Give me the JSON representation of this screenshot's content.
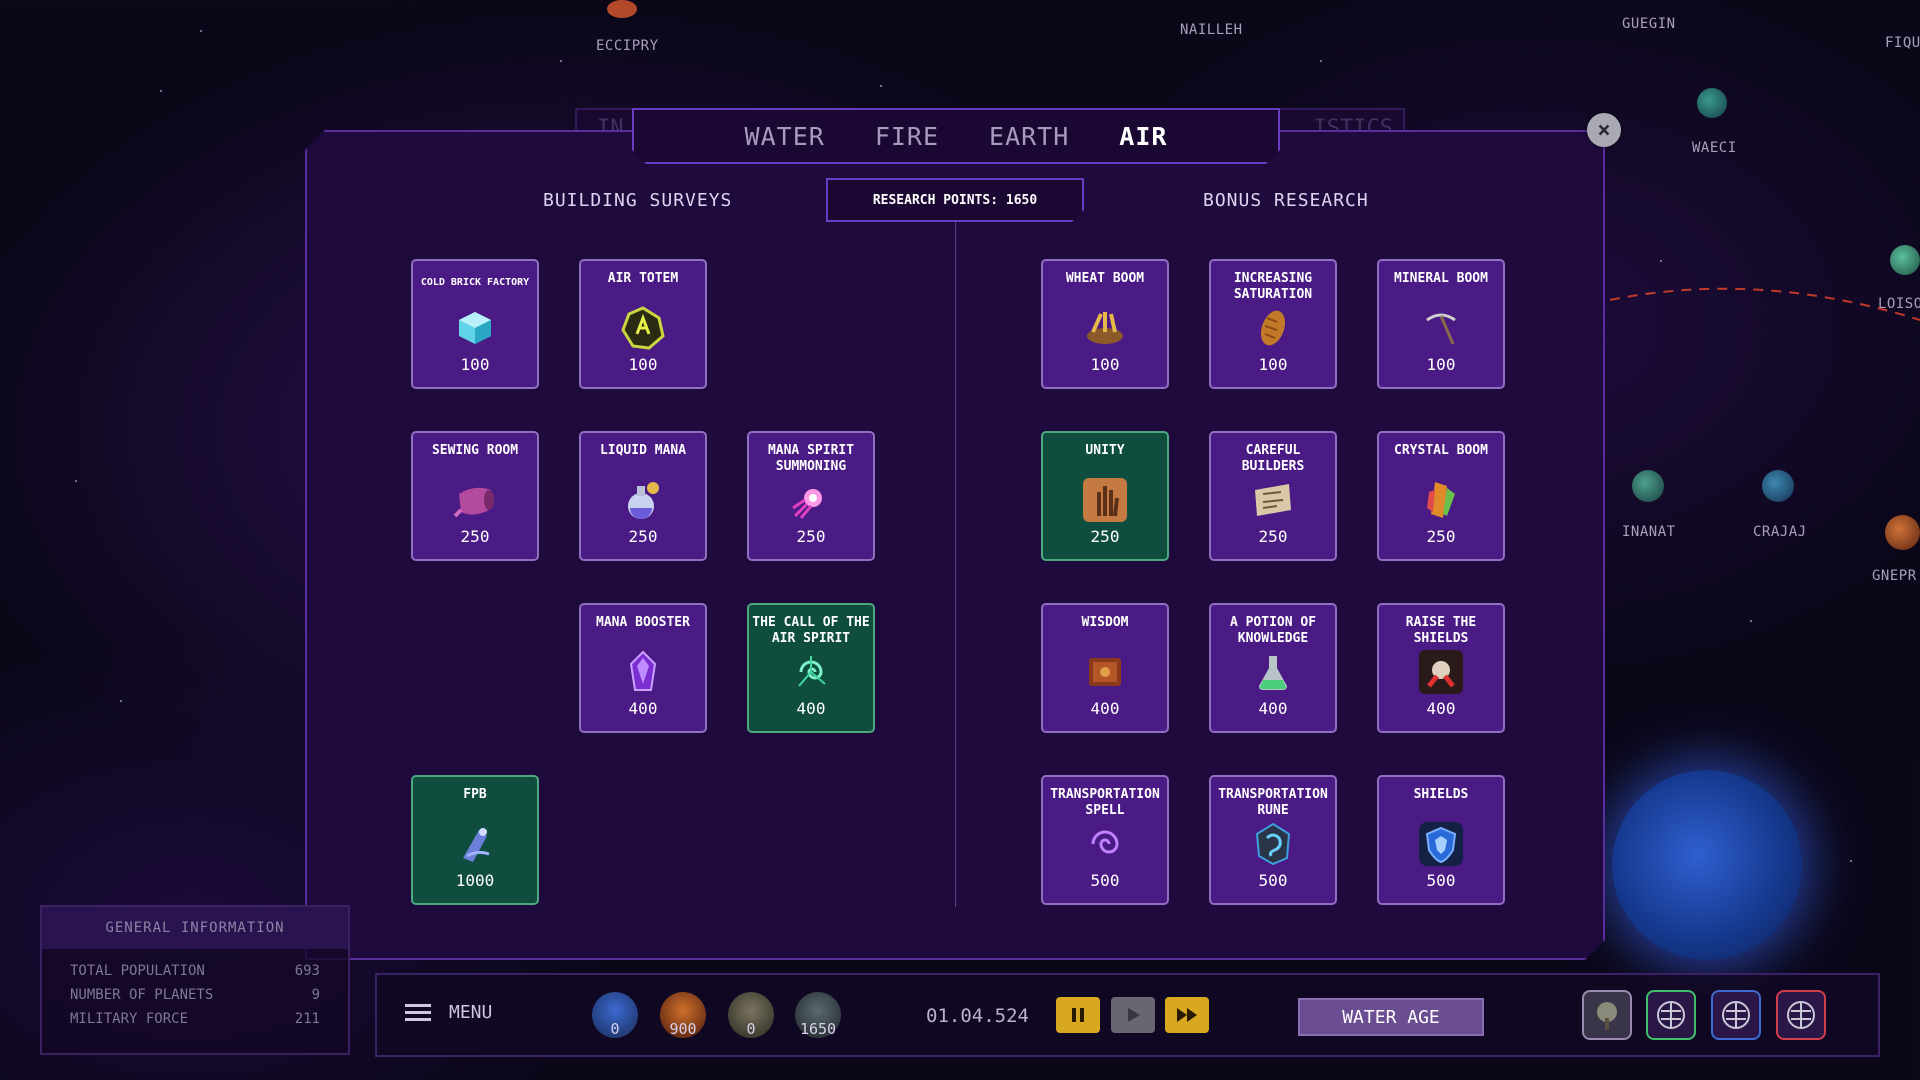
{
  "map": {
    "planets": [
      "ECCIPRY",
      "NAILLEH",
      "GUEGIN",
      "FIQU",
      "WAECI",
      "LOISO",
      "INANAT",
      "CRAJAJ",
      "GNEPR"
    ]
  },
  "tabs": {
    "back_hint": "IN",
    "back_hint_right": "ISTICS",
    "items": [
      "WATER",
      "FIRE",
      "EARTH",
      "AIR"
    ],
    "active": "AIR"
  },
  "close": {
    "label": "×"
  },
  "panel": {
    "left_title": "BUILDING SURVEYS",
    "right_title": "BONUS RESEARCH",
    "research_points": "RESEARCH POINTS: 1650"
  },
  "building_surveys": [
    {
      "name": "COLD BRICK FACTORY",
      "cost": "100",
      "icon": "ice-cube-icon"
    },
    {
      "name": "AIR TOTEM",
      "cost": "100",
      "icon": "air-totem-icon"
    },
    {
      "name": "SEWING ROOM",
      "cost": "250",
      "icon": "fabric-roll-icon"
    },
    {
      "name": "LIQUID MANA",
      "cost": "250",
      "icon": "potion-flask-icon"
    },
    {
      "name": "MANA SPIRIT SUMMONING",
      "cost": "250",
      "icon": "spirit-spark-icon"
    },
    {
      "name": "MANA BOOSTER",
      "cost": "400",
      "icon": "mana-crystal-icon"
    },
    {
      "name": "THE CALL OF THE AIR SPIRIT",
      "cost": "400",
      "icon": "air-swirl-icon",
      "completed": true
    },
    {
      "name": "FPB",
      "cost": "1000",
      "icon": "fpb-icon",
      "completed": true
    }
  ],
  "bonus_research": [
    {
      "name": "WHEAT BOOM",
      "cost": "100",
      "icon": "wheat-icon"
    },
    {
      "name": "INCREASING SATURATION",
      "cost": "100",
      "icon": "bread-icon"
    },
    {
      "name": "MINERAL BOOM",
      "cost": "100",
      "icon": "pickaxe-icon"
    },
    {
      "name": "UNITY",
      "cost": "250",
      "icon": "raised-hand-icon",
      "completed": true
    },
    {
      "name": "CAREFUL BUILDERS",
      "cost": "250",
      "icon": "blueprint-scroll-icon"
    },
    {
      "name": "CRYSTAL BOOM",
      "cost": "250",
      "icon": "crystal-icon"
    },
    {
      "name": "WISDOM",
      "cost": "400",
      "icon": "book-icon"
    },
    {
      "name": "A POTION OF KNOWLEDGE",
      "cost": "400",
      "icon": "green-potion-icon"
    },
    {
      "name": "RAISE THE SHIELDS",
      "cost": "400",
      "icon": "red-spark-icon"
    },
    {
      "name": "TRANSPORTATION SPELL",
      "cost": "500",
      "icon": "swirl-spell-icon"
    },
    {
      "name": "TRANSPORTATION RUNE",
      "cost": "500",
      "icon": "rune-stone-icon"
    },
    {
      "name": "SHIELDS",
      "cost": "500",
      "icon": "shield-icon"
    }
  ],
  "general_info": {
    "title": "GENERAL INFORMATION",
    "rows": [
      {
        "label": "TOTAL POPULATION",
        "value": "693"
      },
      {
        "label": "NUMBER OF PLANETS",
        "value": "9"
      },
      {
        "label": "MILITARY FORCE",
        "value": "211"
      }
    ]
  },
  "bottom_bar": {
    "menu_label": "MENU",
    "resources": [
      {
        "icon": "water-resource-icon",
        "value": "0"
      },
      {
        "icon": "fire-resource-icon",
        "value": "900"
      },
      {
        "icon": "earth-resource-icon",
        "value": "0"
      },
      {
        "icon": "air-resource-icon",
        "value": "1650"
      }
    ],
    "date": "01.04.524",
    "age_label": "WATER AGE"
  },
  "colors": {
    "card_bg": "#4a1b84",
    "card_done_bg": "#0f4e3e",
    "panel_bg": "#1f0a3e",
    "accent": "#6a3bc0"
  }
}
